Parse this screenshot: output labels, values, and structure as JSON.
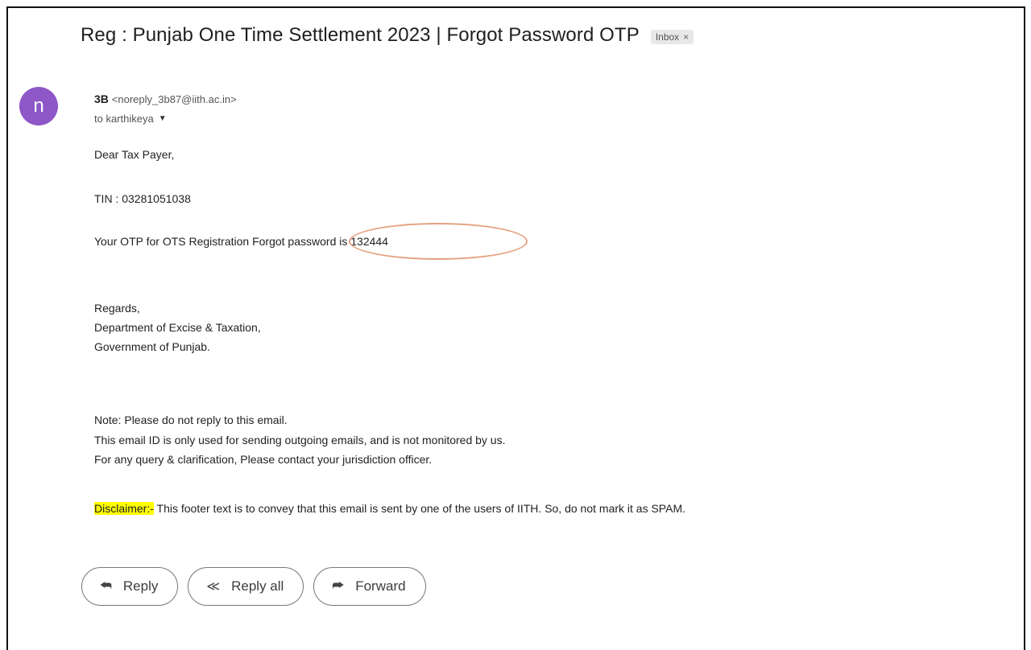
{
  "email": {
    "subject": "Reg : Punjab One Time Settlement 2023 | Forgot Password OTP",
    "label": "Inbox",
    "label_close": "×",
    "avatar_letter": "n",
    "sender_name": "3B",
    "sender_email": "<noreply_3b87@iith.ac.in>",
    "to_text": "to karthikeya",
    "to_caret": "▼",
    "greeting": "Dear Tax Payer,",
    "tin": "TIN : 03281051038",
    "otp_line": "Your OTP for OTS Registration Forgot password is 132444",
    "regards": "Regards,",
    "dept": "Department of Excise & Taxation,",
    "govt": "Government of Punjab.",
    "note1": "Note: Please do not reply to this email.",
    "note2": "This email ID is only used for sending outgoing emails, and is not monitored by us.",
    "note3": "For any query & clarification, Please contact your jurisdiction officer.",
    "disclaimer_label": "Disclaimer:-",
    "disclaimer_text": " This footer text is to convey that this email is sent by one of the users of IITH. So, do not mark it as SPAM."
  },
  "actions": {
    "reply": "Reply",
    "reply_all": "Reply all",
    "forward": "Forward"
  },
  "icons": {
    "reply": "reply-icon",
    "reply_all": "reply-all-icon",
    "forward": "forward-icon"
  },
  "colors": {
    "avatar": "#8e57c8",
    "highlight": "#ffff00",
    "annotation_oval": "#e4a27f"
  }
}
